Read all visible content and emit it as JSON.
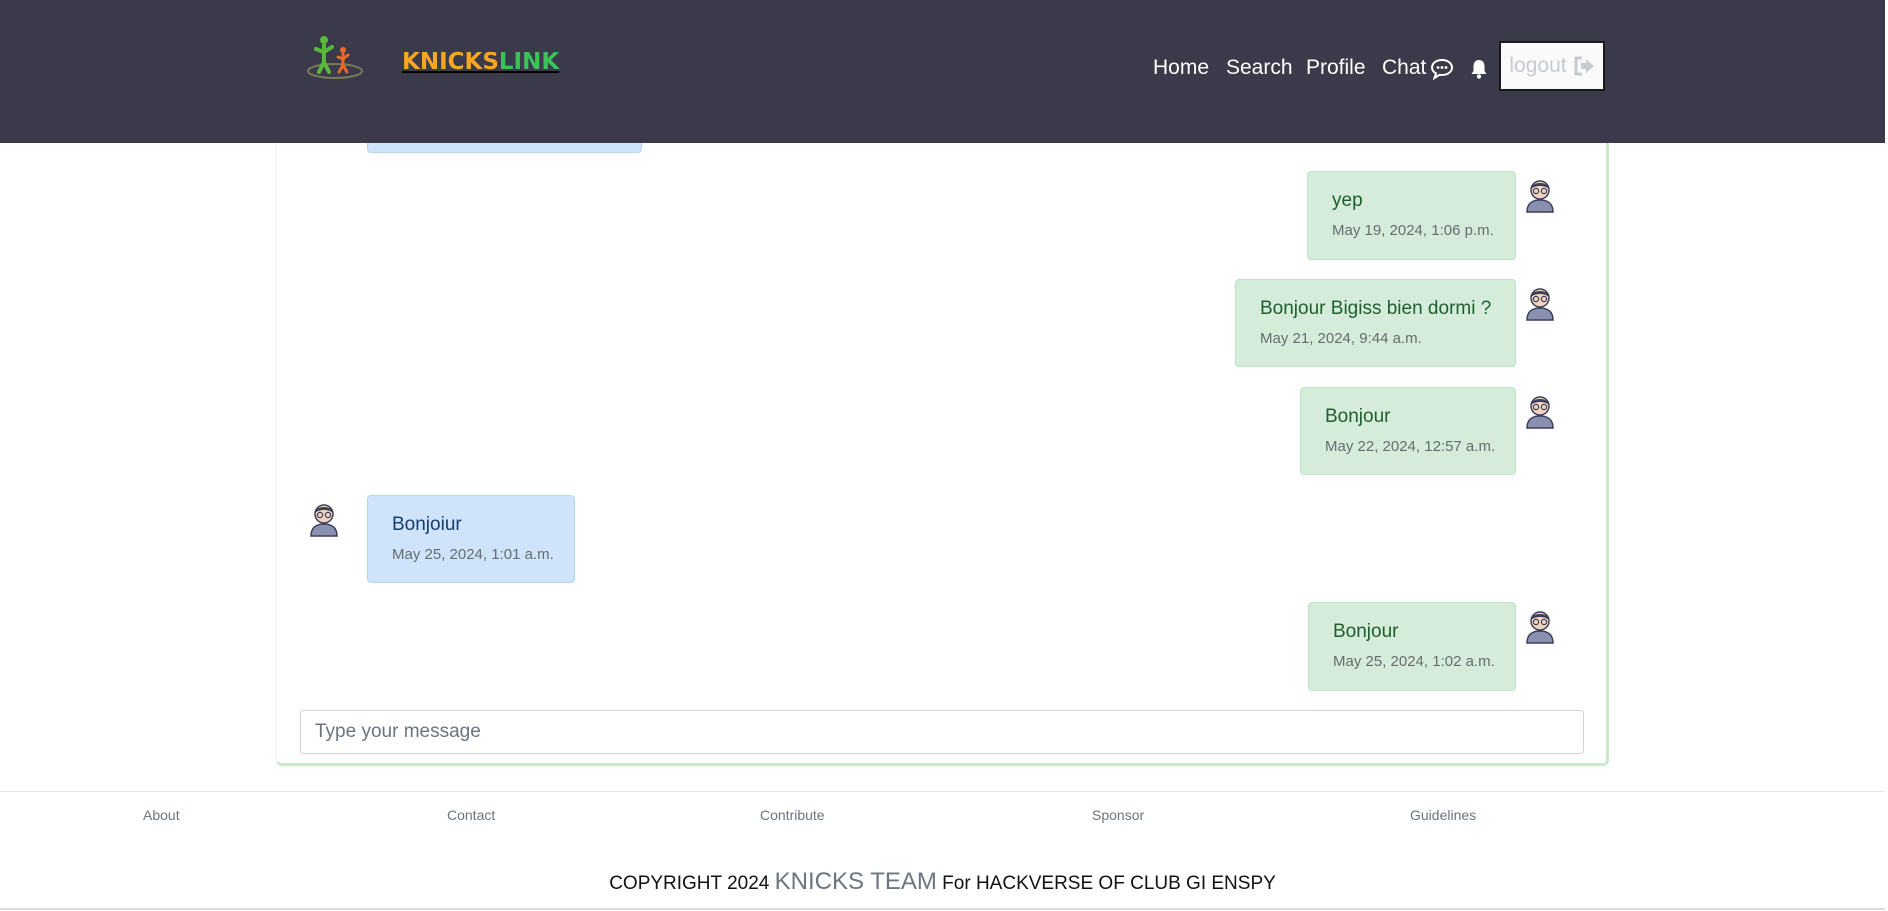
{
  "header": {
    "brand_part1": "KNICKS",
    "brand_part2": "LINK",
    "nav": {
      "home": "Home",
      "search": "Search",
      "profile": "Profile",
      "chat": "Chat"
    },
    "logout_label": "logout",
    "colors": {
      "background": "#3a3a4a",
      "brand_orange": "#f5a623",
      "brand_green": "#3cc25a"
    }
  },
  "chat": {
    "messages": [
      {
        "direction": "sent",
        "text": "yep",
        "timestamp": "May 19, 2024, 1:06 p.m."
      },
      {
        "direction": "sent",
        "text": "Bonjour Bigiss bien dormi ?",
        "timestamp": "May 21, 2024, 9:44 a.m."
      },
      {
        "direction": "sent",
        "text": "Bonjour",
        "timestamp": "May 22, 2024, 12:57 a.m."
      },
      {
        "direction": "received",
        "text": "Bonjoiur",
        "timestamp": "May 25, 2024, 1:01 a.m."
      },
      {
        "direction": "sent",
        "text": "Bonjour",
        "timestamp": "May 25, 2024, 1:02 a.m."
      }
    ],
    "input_placeholder": "Type your message",
    "colors": {
      "sent_bubble": "#d4ecd9",
      "received_bubble": "#cfe3fb",
      "card_border": "#c8ecc9"
    }
  },
  "footer": {
    "links": {
      "about": "About",
      "contact": "Contact",
      "contribute": "Contribute",
      "sponsor": "Sponsor",
      "guidelines": "Guidelines"
    },
    "copyright_prefix": "COPYRIGHT 2024 ",
    "copyright_team": "KNICKS TEAM",
    "copyright_suffix": " For HACKVERSE OF CLUB GI ENSPY"
  },
  "icons": [
    "app-logo-icon",
    "chat-bubble-icon",
    "bell-icon",
    "logout-icon",
    "user-avatar-icon"
  ]
}
